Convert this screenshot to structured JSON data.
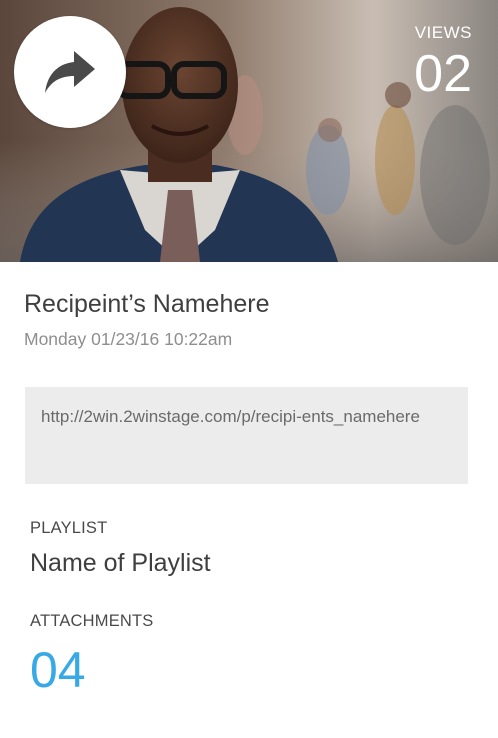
{
  "hero": {
    "views_label": "VIEWS",
    "views_count": "02"
  },
  "share": {
    "icon": "share-arrow-icon"
  },
  "recipient": {
    "name": "Recipeint’s Namehere",
    "timestamp": "Monday 01/23/16 10:22am"
  },
  "link": {
    "url": "http://2win.2winstage.com/p/recipi-ents_namehere"
  },
  "playlist": {
    "label": "PLAYLIST",
    "name": "Name of Playlist"
  },
  "attachments": {
    "label": "ATTACHMENTS",
    "count": "04"
  },
  "colors": {
    "accent": "#39a9e6",
    "link_box_bg": "#ececec",
    "share_button_bg": "#ffffff"
  }
}
